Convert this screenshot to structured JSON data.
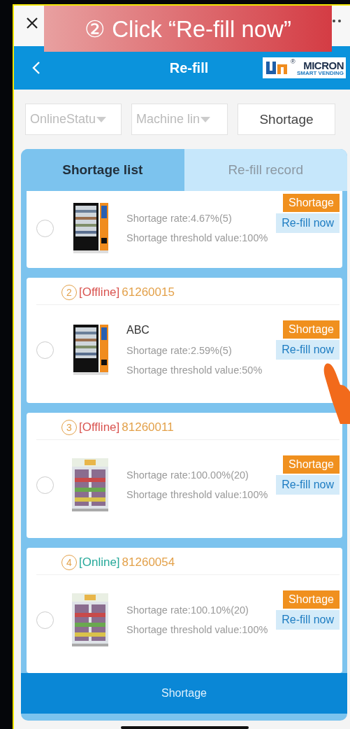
{
  "caption": "② Click “Re-fill now”",
  "header": {
    "title": "Re-fill",
    "logo": {
      "name": "MICRON",
      "mark": "®",
      "tagline": "SMART VENDING"
    }
  },
  "filters": [
    {
      "kind": "dropdown",
      "placeholder": "OnlineStatu"
    },
    {
      "kind": "dropdown",
      "placeholder": "Machine lin"
    },
    {
      "kind": "button",
      "label": "Shortage"
    }
  ],
  "tabs": [
    {
      "label": "Shortage list",
      "selected": true
    },
    {
      "label": "Re-fill record",
      "selected": false
    }
  ],
  "machines": [
    {
      "selected": false,
      "kind": "picture",
      "rate": "Shortage rate:4.67%(5)",
      "threshold": "Shortage threshold value:100%",
      "shortage_button": "Shortage",
      "refill_button": "Re-fill now"
    },
    {
      "selected": false,
      "number": "2",
      "status": "[Offline]",
      "color": "#d9534f",
      "code": "61260015",
      "kind": "picture",
      "name": "ABC",
      "rate": "Shortage rate:2.59%(5)",
      "threshold": "Shortage threshold value:50%",
      "shortage_button": "Shortage",
      "refill_button": "Re-fill now"
    },
    {
      "selected": false,
      "number": "3",
      "status": "[Offline]",
      "color": "#d9534f",
      "code": "81260011",
      "kind": "picture",
      "rate": "Shortage rate:100.00%(20)",
      "threshold": "Shortage threshold value:100%",
      "shortage_button": "Shortage",
      "refill_button": "Re-fill now"
    },
    {
      "selected": false,
      "number": "4",
      "status": "[Online]",
      "color": "#27a99a",
      "code": "81260054",
      "kind": "picture",
      "rate": "Shortage rate:100.10%(20)",
      "threshold": "Shortage threshold value:100%",
      "shortage_button": "Shortage",
      "refill_button": "Re-fill now"
    }
  ],
  "bottom_button": "Shortage"
}
